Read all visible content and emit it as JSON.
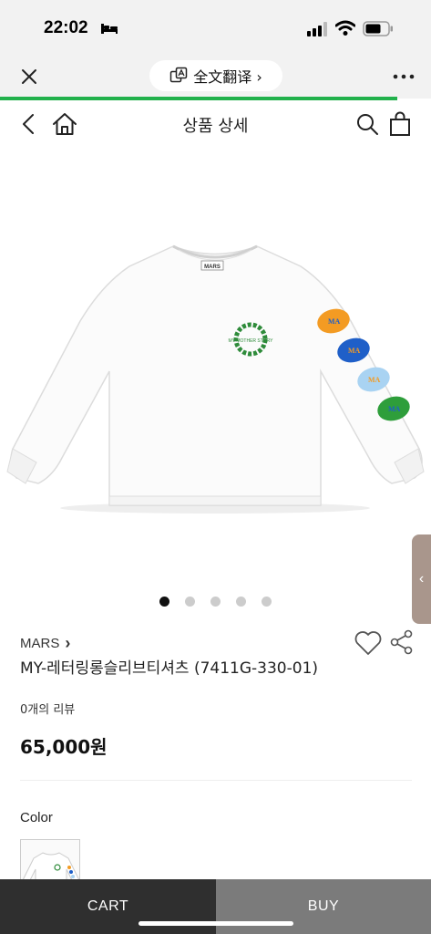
{
  "status_bar": {
    "time": "22:02",
    "icons": [
      "bed-icon",
      "signal-icon",
      "wifi-icon",
      "battery-icon"
    ]
  },
  "browser_bar": {
    "translate_label": "全文翻译 ›",
    "icons": [
      "close-icon",
      "translate-icon",
      "more-icon"
    ],
    "accent_color": "#22b14c"
  },
  "header": {
    "title": "상품 상세",
    "icons": [
      "back-icon",
      "home-icon",
      "search-icon",
      "shopping-bag-icon"
    ]
  },
  "carousel": {
    "total": 5,
    "active_index": 0
  },
  "product": {
    "brand": "MARS",
    "brand_arrow": "›",
    "name": "MY-레터링롱슬리브티셔츠 (7411G-330-01)",
    "reviews": "0개의 리뷰",
    "price": "65,000원",
    "logo_text": "MARS",
    "print_text": "MY MOTHER STORY"
  },
  "options": {
    "color_label": "Color"
  },
  "side_tab": {
    "arrow": "‹"
  },
  "bottom_bar": {
    "cart_label": "CART",
    "buy_label": "BUY",
    "colors": {
      "cart": "#2f2f2f",
      "buy": "#7b7b7b"
    }
  }
}
